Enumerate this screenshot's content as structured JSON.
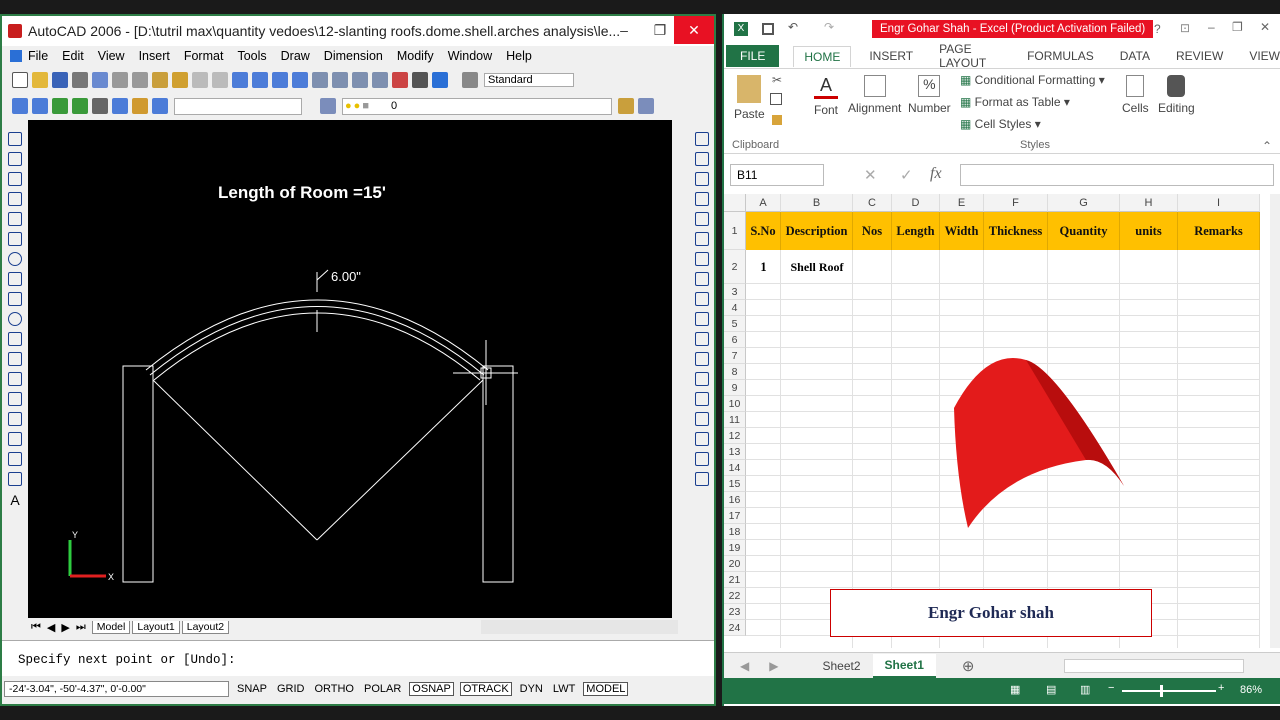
{
  "acad": {
    "title": "AutoCAD 2006 - [D:\\tutril max\\quantity vedoes\\12-slanting roofs.dome.shell.arches analysis\\le...",
    "menu": [
      "File",
      "Edit",
      "View",
      "Insert",
      "Format",
      "Tools",
      "Draw",
      "Dimension",
      "Modify",
      "Window",
      "Help"
    ],
    "style_combo": "Standard",
    "layer_value": "0",
    "drawing_label": "Length of Room =15'",
    "dimension_text": "6.00\"",
    "ucs_y": "Y",
    "ucs_x": "X",
    "tabs": [
      "Model",
      "Layout1",
      "Layout2"
    ],
    "command_line": "Specify next point or [Undo]:",
    "coords": "-24'-3.04\", -50'-4.37\", 0'-0.00\"",
    "status_buttons": [
      "SNAP",
      "GRID",
      "ORTHO",
      "POLAR",
      "OSNAP",
      "OTRACK",
      "DYN",
      "LWT",
      "MODEL"
    ]
  },
  "excel": {
    "title": "Engr Gohar Shah -  Excel (Product Activation Failed)",
    "help": "?",
    "ribbon_tabs": [
      "FILE",
      "HOME",
      "INSERT",
      "PAGE LAYOUT",
      "FORMULAS",
      "DATA",
      "REVIEW",
      "VIEW"
    ],
    "groups": {
      "paste": "Paste",
      "clipboard": "Clipboard",
      "font": "Font",
      "alignment": "Alignment",
      "number": "Number",
      "cond_fmt": "Conditional Formatting",
      "format_table": "Format as Table",
      "cell_styles": "Cell Styles",
      "styles": "Styles",
      "cells": "Cells",
      "editing": "Editing",
      "percent": "%"
    },
    "name_box": "B11",
    "fx": "fx",
    "columns": [
      "A",
      "B",
      "C",
      "D",
      "E",
      "F",
      "G",
      "H",
      "I"
    ],
    "headers": [
      "S.No",
      "Description",
      "Nos",
      "Length",
      "Width",
      "Thickness",
      "Quantity",
      "units",
      "Remarks"
    ],
    "row2": {
      "sno": "1",
      "desc": "Shell Roof"
    },
    "rows": [
      "1",
      "2",
      "3",
      "4",
      "5",
      "6",
      "7",
      "8",
      "9",
      "10",
      "11",
      "12",
      "13",
      "14",
      "15",
      "16",
      "17",
      "18",
      "19",
      "20",
      "21",
      "22",
      "23",
      "24"
    ],
    "name_box_text": "Engr Gohar shah",
    "sheets": [
      "Sheet2",
      "Sheet1"
    ],
    "zoom": "86%"
  }
}
